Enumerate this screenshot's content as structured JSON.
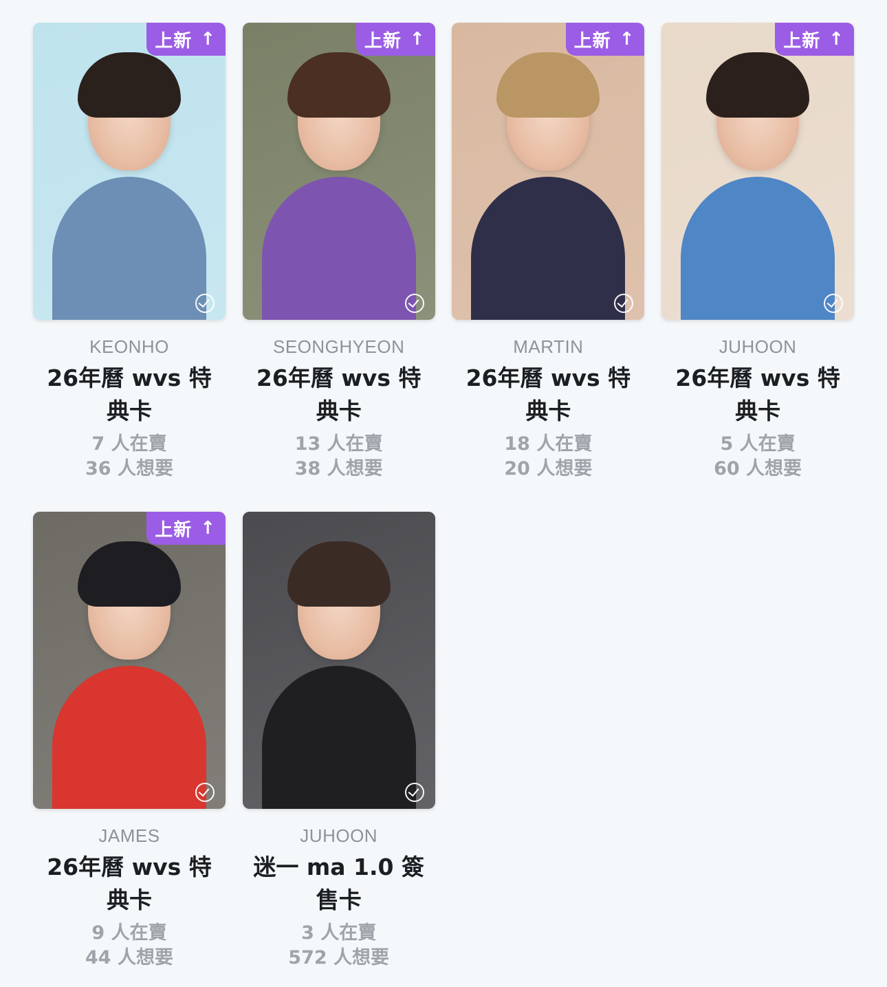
{
  "cards": [
    {
      "badge": {
        "label": "上新",
        "arrow": "↑"
      },
      "member": "KEONHO",
      "title": "26年曆 wvs 特典卡",
      "sellers": "7 人在賣",
      "wanters": "36 人想要",
      "colors": {
        "bg": "#bfe3ee",
        "hair": "#2a211c",
        "body": "#6d8fb5"
      }
    },
    {
      "badge": {
        "label": "上新",
        "arrow": "↑"
      },
      "member": "SEONGHYEON",
      "title": "26年曆 wvs 特典卡",
      "sellers": "13 人在賣",
      "wanters": "38 人想要",
      "colors": {
        "bg": "#7a8066",
        "hair": "#4a2f22",
        "body": "#7d54b0"
      }
    },
    {
      "badge": {
        "label": "上新",
        "arrow": "↑"
      },
      "member": "MARTIN",
      "title": "26年曆 wvs 特典卡",
      "sellers": "18 人在賣",
      "wanters": "20 人想要",
      "colors": {
        "bg": "#d9b8a0",
        "hair": "#b99663",
        "body": "#2f2f4a"
      }
    },
    {
      "badge": {
        "label": "上新",
        "arrow": "↑"
      },
      "member": "JUHOON",
      "title": "26年曆 wvs 特典卡",
      "sellers": "5 人在賣",
      "wanters": "60 人想要",
      "colors": {
        "bg": "#e8d9c9",
        "hair": "#2b201c",
        "body": "#4f86c6"
      }
    },
    {
      "badge": {
        "label": "上新",
        "arrow": "↑"
      },
      "member": "JAMES",
      "title": "26年曆 wvs 特典卡",
      "sellers": "9 人在賣",
      "wanters": "44 人想要",
      "colors": {
        "bg": "#6e6a64",
        "hair": "#1e1d22",
        "body": "#d8362e"
      }
    },
    {
      "badge": null,
      "member": "JUHOON",
      "title": "迷一 ma 1.0 簽售卡",
      "sellers": "3 人在賣",
      "wanters": "572 人想要",
      "colors": {
        "bg": "#4b4b4f",
        "hair": "#3a2b25",
        "body": "#1f1f22"
      }
    }
  ]
}
